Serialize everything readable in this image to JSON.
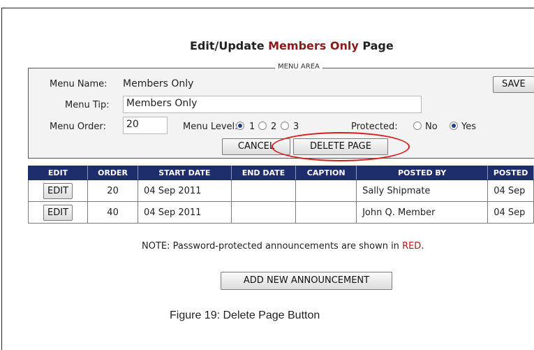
{
  "page": {
    "title_prefix": "Edit/Update ",
    "title_accent": "Members Only",
    "title_suffix": " Page"
  },
  "menu_area": {
    "legend": "MENU AREA",
    "menu_name_label": "Menu Name:",
    "menu_name_value": "Members Only",
    "menu_tip_label": "Menu Tip:",
    "menu_tip_value": "Members Only",
    "menu_order_label": "Menu Order:",
    "menu_order_value": "20",
    "menu_level_label": "Menu Level:",
    "menu_level_options": [
      "1",
      "2",
      "3"
    ],
    "menu_level_selected": "1",
    "protected_label": "Protected:",
    "protected_options": [
      "No",
      "Yes"
    ],
    "protected_selected": "Yes",
    "save_label": "SAVE",
    "cancel_label": "CANCEL",
    "delete_label": "DELETE PAGE"
  },
  "table": {
    "headers": [
      "EDIT",
      "ORDER",
      "START DATE",
      "END DATE",
      "CAPTION",
      "POSTED BY",
      "POSTED"
    ],
    "rows": [
      {
        "edit": "EDIT",
        "order": "20",
        "start": "04 Sep 2011",
        "end": "",
        "caption": "",
        "posted_by": "Sally Shipmate",
        "posted": "04 Sep"
      },
      {
        "edit": "EDIT",
        "order": "40",
        "start": "04 Sep 2011",
        "end": "",
        "caption": "",
        "posted_by": "John Q. Member",
        "posted": "04 Sep"
      }
    ]
  },
  "note": {
    "prefix": "NOTE: Password-protected announcements are shown in ",
    "red_word": "RED",
    "suffix": "."
  },
  "add_button_label": "ADD NEW ANNOUNCEMENT",
  "figure_caption": "Figure 19: Delete Page Button",
  "colors": {
    "accent": "#8b1a1a",
    "table_header": "#1e2d6b",
    "highlight": "#d51f1f"
  }
}
